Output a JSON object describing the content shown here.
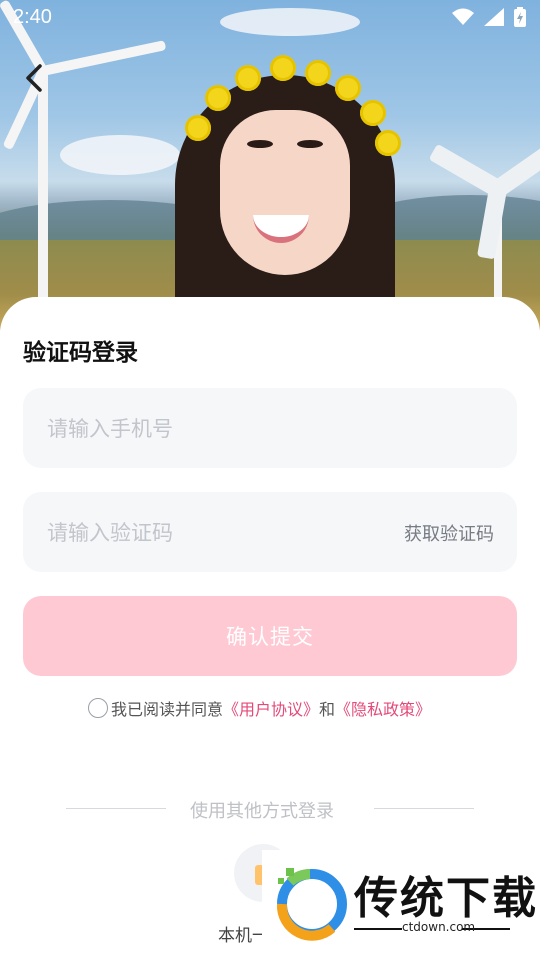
{
  "status_bar": {
    "time": "2:40"
  },
  "form": {
    "title": "验证码登录",
    "phone_placeholder": "请输入手机号",
    "code_placeholder": "请输入验证码",
    "get_code_label": "获取验证码",
    "submit_label": "确认提交",
    "agreement": {
      "prefix": "我已阅读并同意",
      "user_agreement": "《用户协议》",
      "conjunction": "和",
      "privacy_policy": "《隐私政策》"
    }
  },
  "other_login": {
    "divider_text": "使用其他方式登录",
    "method_label": "本机一"
  },
  "watermark": {
    "brand": "传统下载",
    "url": "ctdown.com"
  },
  "colors": {
    "accent": "#e44a79",
    "submit_bg": "#ffc9d4",
    "input_bg": "#f6f7f9"
  }
}
